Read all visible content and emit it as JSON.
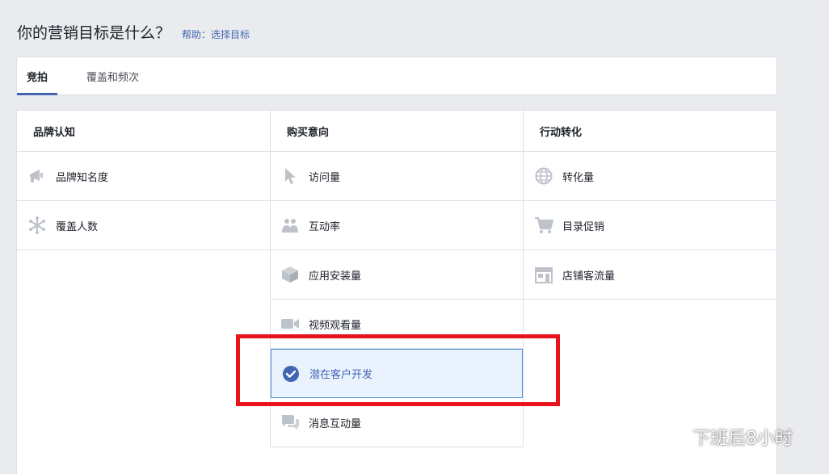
{
  "page": {
    "title": "你的营销目标是什么？",
    "help_link": "帮助：选择目标"
  },
  "tabs": [
    {
      "label": "竞拍",
      "active": true
    },
    {
      "label": "覆盖和频次",
      "active": false
    }
  ],
  "columns": [
    {
      "header": "品牌认知",
      "options": [
        {
          "label": "品牌知名度",
          "icon": "megaphone-icon"
        },
        {
          "label": "覆盖人数",
          "icon": "reach-network-icon"
        }
      ]
    },
    {
      "header": "购买意向",
      "options": [
        {
          "label": "访问量",
          "icon": "cursor-icon"
        },
        {
          "label": "互动率",
          "icon": "people-icon"
        },
        {
          "label": "应用安装量",
          "icon": "box-icon"
        },
        {
          "label": "视频观看量",
          "icon": "video-camera-icon"
        },
        {
          "label": "潜在客户开发",
          "icon": "check-circle-icon",
          "selected": true
        },
        {
          "label": "消息互动量",
          "icon": "chat-bubbles-icon"
        }
      ]
    },
    {
      "header": "行动转化",
      "options": [
        {
          "label": "转化量",
          "icon": "globe-icon"
        },
        {
          "label": "目录促销",
          "icon": "shopping-cart-icon"
        },
        {
          "label": "店铺客流量",
          "icon": "storefront-icon"
        }
      ]
    }
  ],
  "colors": {
    "accent": "#4267b2",
    "selected_bg": "#eaf3fd",
    "selected_border": "#4b90d8",
    "highlight_red": "#e8141b",
    "icon_gray": "#bec3c9"
  },
  "watermark": {
    "text": "下班后8小时",
    "icon": "wechat-icon"
  }
}
